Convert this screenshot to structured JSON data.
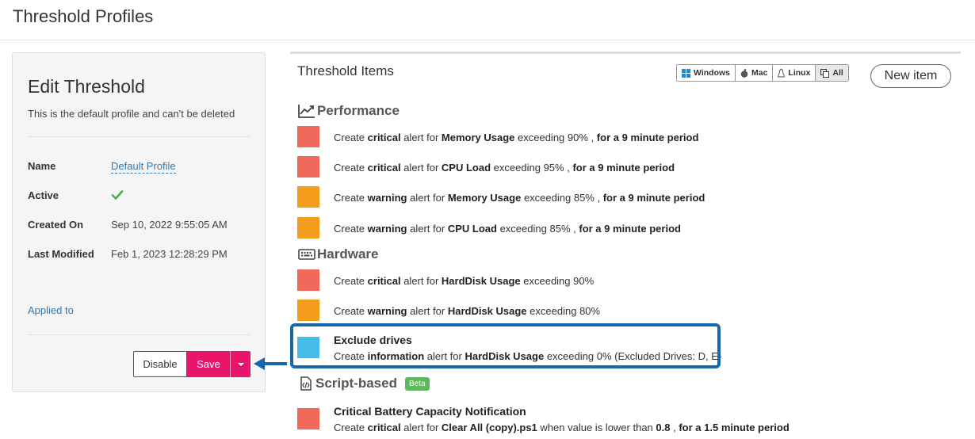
{
  "page": {
    "title": "Threshold Profiles"
  },
  "edit_panel": {
    "title": "Edit Threshold",
    "subtitle": "This is the default profile and can't be deleted",
    "fields": {
      "name_label": "Name",
      "name_value": "Default Profile",
      "active_label": "Active",
      "created_label": "Created On",
      "created_value": "Sep 10, 2022 9:55:05 AM",
      "modified_label": "Last Modified",
      "modified_value": "Feb 1, 2023 12:28:29 PM"
    },
    "applied_to": "Applied to",
    "buttons": {
      "disable": "Disable",
      "save": "Save"
    }
  },
  "items_panel": {
    "title": "Threshold Items",
    "os_filter": [
      {
        "label": "Windows",
        "icon": "windows-icon"
      },
      {
        "label": "Mac",
        "icon": "apple-icon"
      },
      {
        "label": "Linux",
        "icon": "linux-icon"
      },
      {
        "label": "All",
        "icon": "copy-icon",
        "active": true
      }
    ],
    "new_item": "New item",
    "sections": {
      "performance": "Performance",
      "hardware": "Hardware",
      "script": "Script-based",
      "beta": "Beta"
    },
    "colors": {
      "critical": "#f0695a",
      "warning": "#f49c1c",
      "information": "#45bde8",
      "highlight": "#1568ae",
      "save": "#e8156b"
    },
    "text": {
      "create": "Create",
      "alert_for": "alert for",
      "exceeding": "exceeding",
      "for_a": "for a",
      "minute_period": "minute period"
    },
    "items": [
      {
        "level": "critical",
        "metric": "Memory Usage",
        "threshold": "90%",
        "duration": "9"
      },
      {
        "level": "critical",
        "metric": "CPU Load",
        "threshold": "95%",
        "duration": "9"
      },
      {
        "level": "warning",
        "metric": "Memory Usage",
        "threshold": "85%",
        "duration": "9"
      },
      {
        "level": "warning",
        "metric": "CPU Load",
        "threshold": "85%",
        "duration": "9"
      },
      {
        "level": "critical",
        "metric": "HardDisk Usage",
        "threshold": "90%"
      },
      {
        "level": "warning",
        "metric": "HardDisk Usage",
        "threshold": "80%"
      },
      {
        "name": "Exclude drives",
        "level": "information",
        "metric": "HardDisk Usage",
        "threshold": "0%",
        "extra": "(Excluded Drives: D, E)"
      },
      {
        "name": "Critical Battery Capacity Notification",
        "level": "critical",
        "script": "Clear All (copy).ps1",
        "when_text": "when value is lower than",
        "value": "0.8",
        "duration": "1.5"
      }
    ]
  }
}
